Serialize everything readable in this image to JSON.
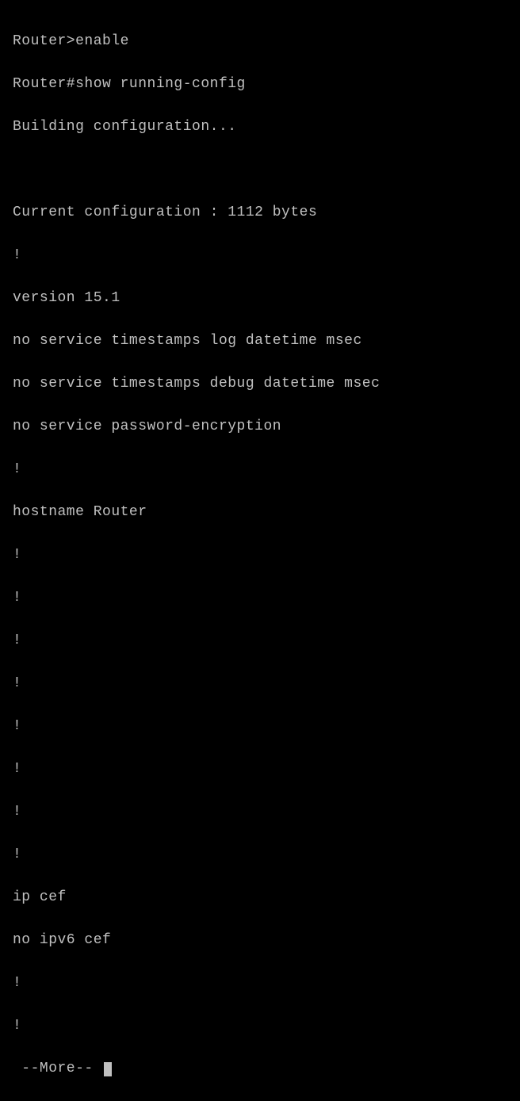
{
  "terminal": {
    "lines": [
      "Router>enable",
      "Router#show running-config",
      "Building configuration...",
      "",
      "Current configuration : 1112 bytes",
      "!",
      "version 15.1",
      "no service timestamps log datetime msec",
      "no service timestamps debug datetime msec",
      "no service password-encryption",
      "!",
      "hostname Router",
      "!",
      "!",
      "!",
      "!",
      "!",
      "!",
      "!",
      "!",
      "ip cef",
      "no ipv6 cef",
      "!",
      "!"
    ],
    "more_prompt": " --More-- "
  }
}
